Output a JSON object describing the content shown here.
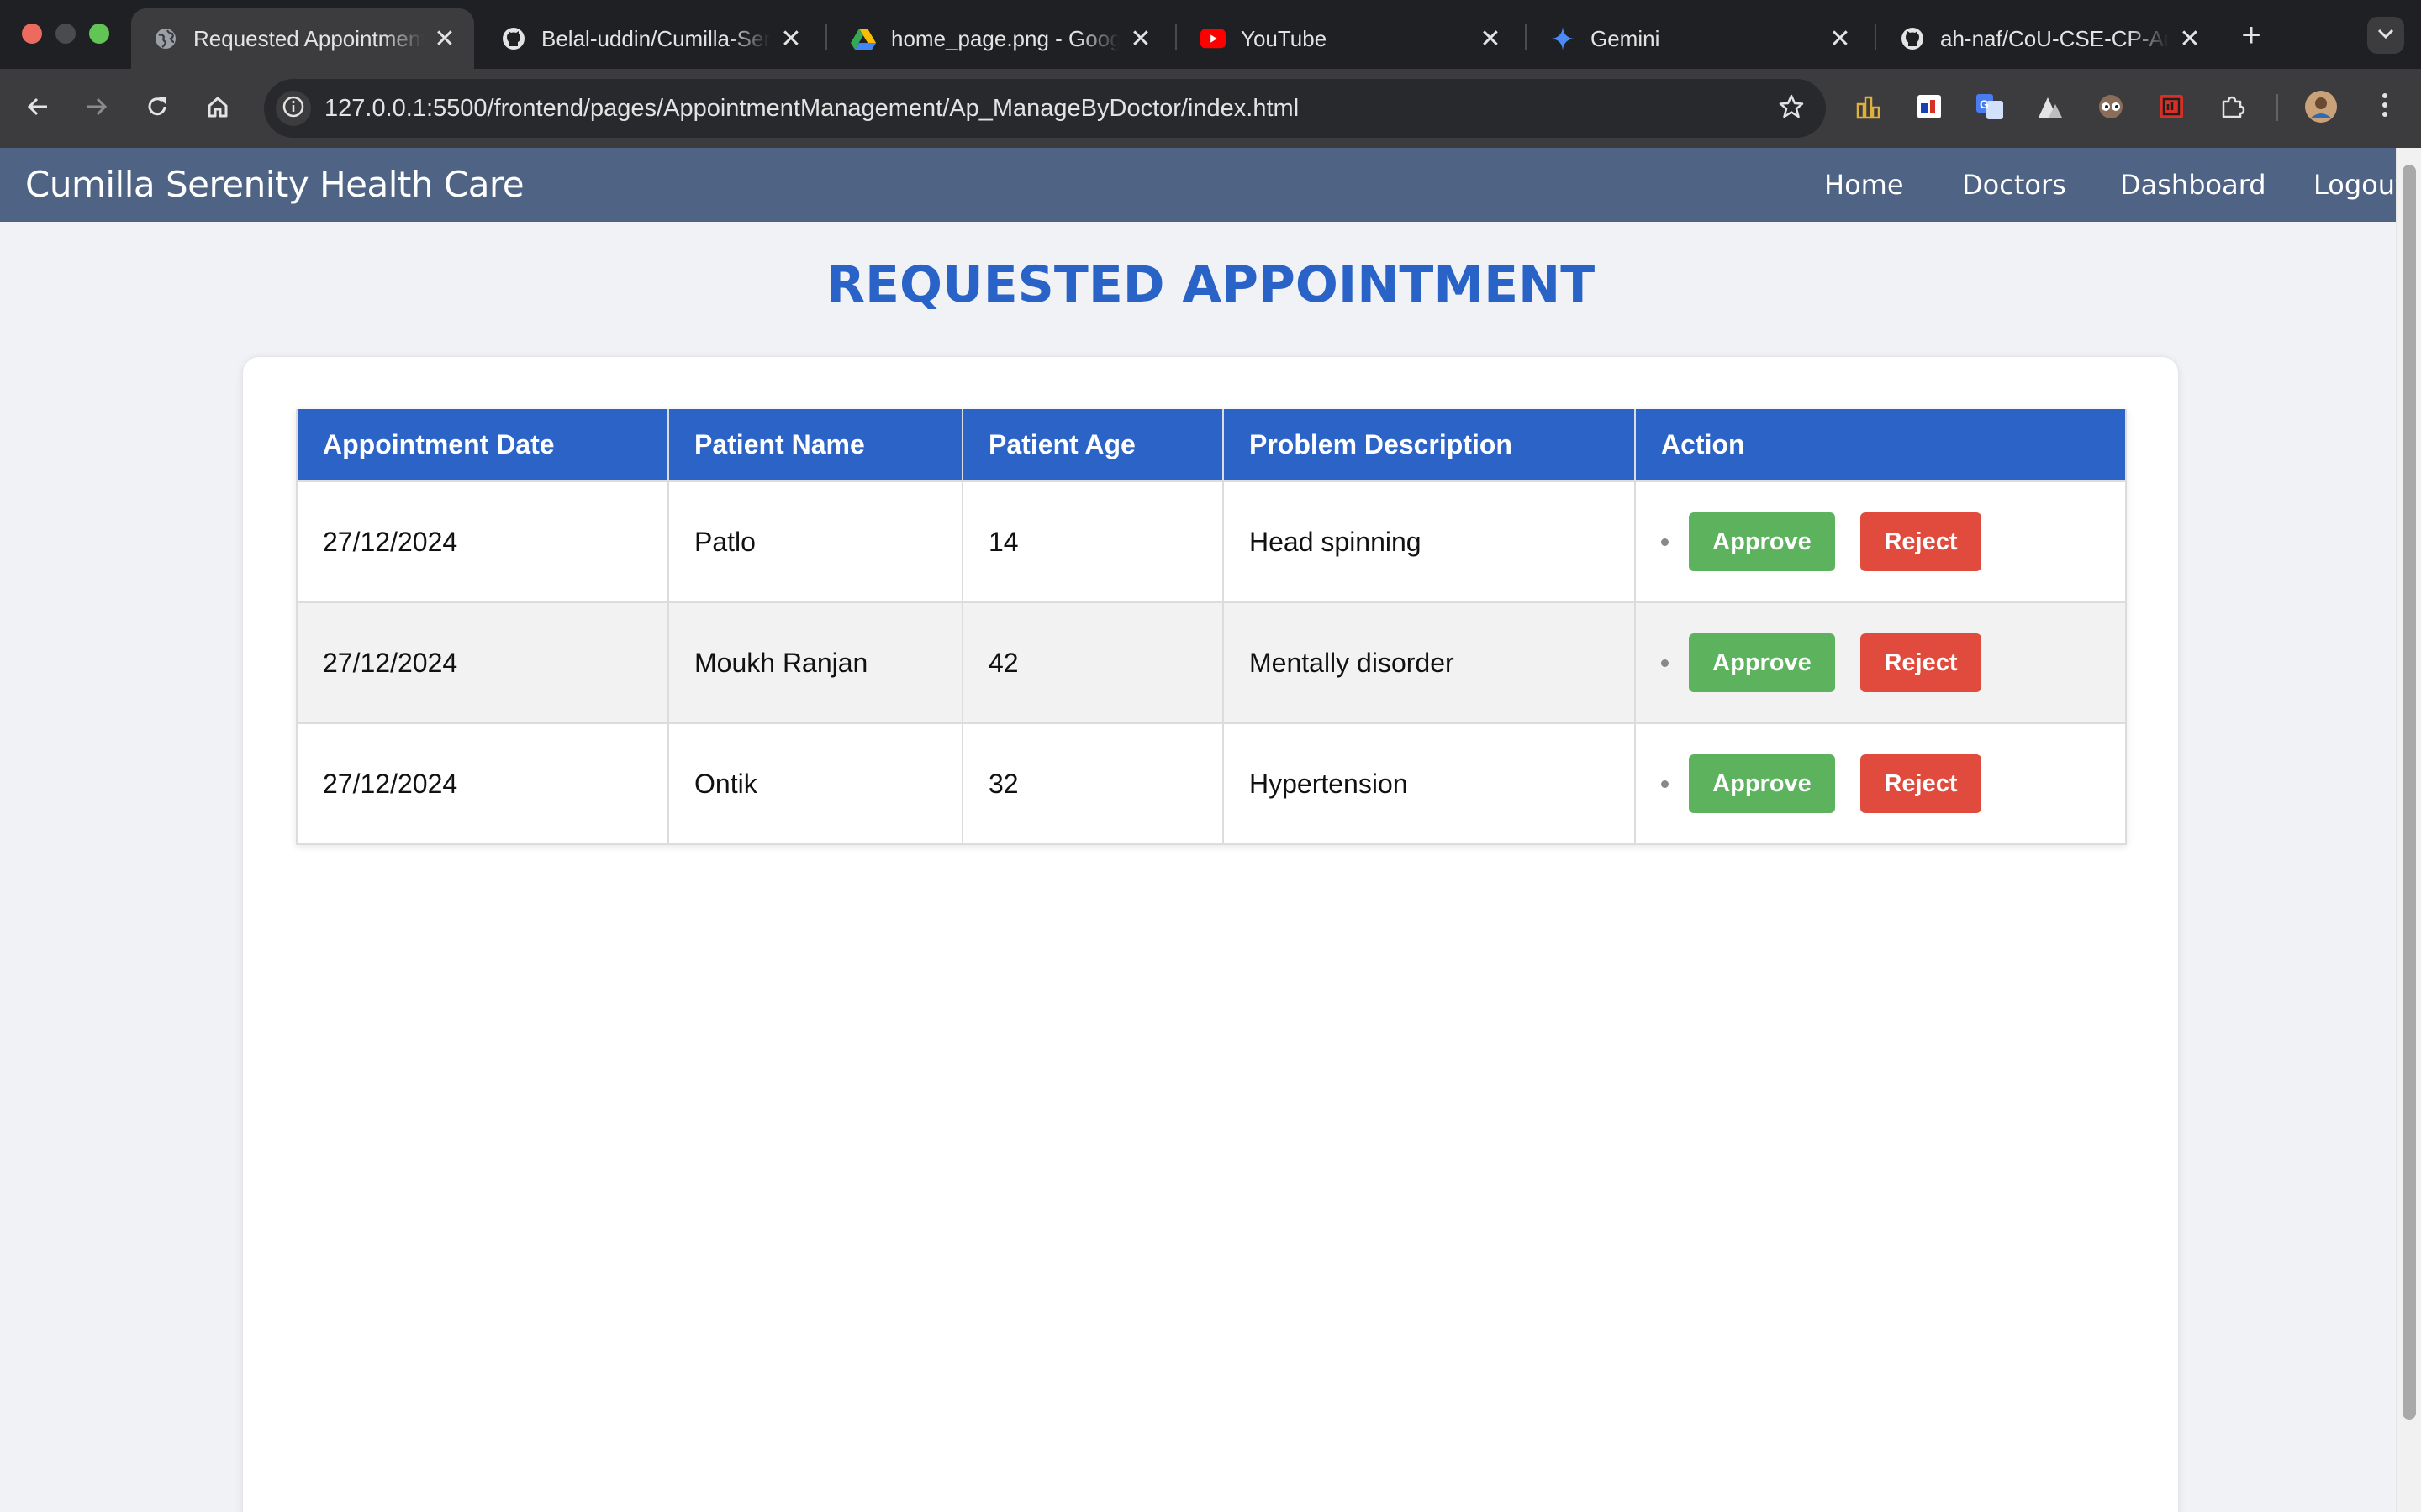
{
  "browser": {
    "tabs": [
      {
        "title": "Requested Appointment",
        "icon": "globe-icon",
        "active": true
      },
      {
        "title": "Belal-uddin/Cumilla-Serenity",
        "icon": "github-icon",
        "active": false
      },
      {
        "title": "home_page.png - Google Drive",
        "icon": "google-drive-icon",
        "active": false
      },
      {
        "title": "YouTube",
        "icon": "youtube-icon",
        "active": false
      },
      {
        "title": "Gemini",
        "icon": "gemini-icon",
        "active": false
      },
      {
        "title": "ah-naf/CoU-CSE-CP-Archive",
        "icon": "github-icon",
        "active": false
      }
    ],
    "url": "127.0.0.1:5500/frontend/pages/AppointmentManagement/Ap_ManageByDoctor/index.html",
    "close_glyph": "✕",
    "new_tab_glyph": "+"
  },
  "site": {
    "brand": "Cumilla Serenity Health Care",
    "nav": [
      "Home",
      "Doctors",
      "Dashboard",
      "Logout"
    ]
  },
  "page": {
    "title": "REQUESTED APPOINTMENT"
  },
  "table": {
    "headers": [
      "Appointment Date",
      "Patient Name",
      "Patient Age",
      "Problem Description",
      "Action"
    ],
    "rows": [
      {
        "date": "27/12/2024",
        "name": "Patlo",
        "age": "14",
        "problem": "Head spinning"
      },
      {
        "date": "27/12/2024",
        "name": "Moukh Ranjan",
        "age": "42",
        "problem": "Mentally disorder"
      },
      {
        "date": "27/12/2024",
        "name": "Ontik",
        "age": "32",
        "problem": "Hypertension"
      }
    ],
    "approve_label": "Approve",
    "reject_label": "Reject"
  },
  "colors": {
    "nav_bg": "#4f6384",
    "title": "#2963c7",
    "header_bg": "#2b63c6",
    "approve": "#5cb25d",
    "reject": "#e04b3d"
  }
}
